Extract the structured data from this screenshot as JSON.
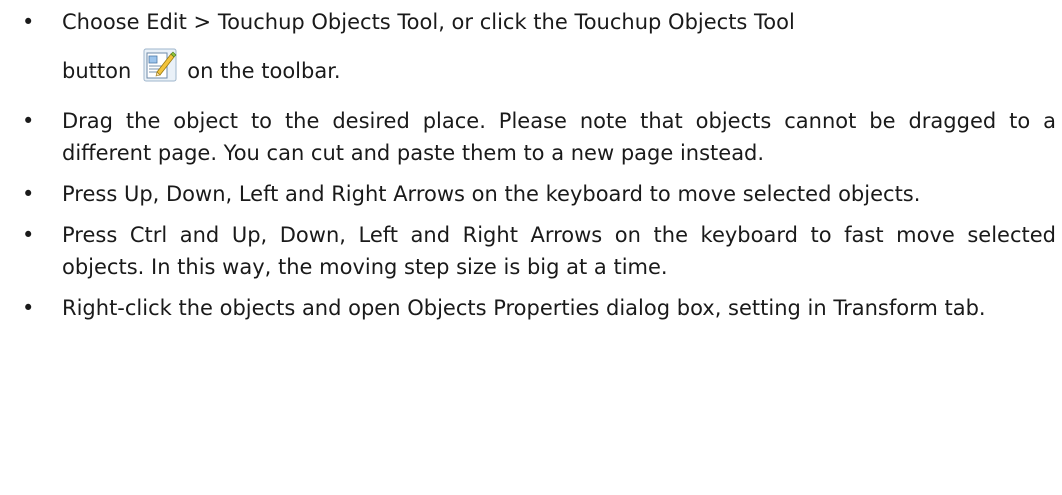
{
  "bullet_glyph": "•",
  "items": [
    {
      "line1": "Choose Edit > Touchup Objects Tool, or click the Touchup Objects Tool",
      "pre_icon": "button",
      "icon": "touchup-objects-tool-icon",
      "post_icon": "on the toolbar."
    },
    {
      "text": "Drag the object to the desired place. Please note that objects cannot be dragged to a different page. You can cut and paste them to a new page instead."
    },
    {
      "text": "Press Up, Down, Left and Right Arrows on the keyboard to move selected objects."
    },
    {
      "text": "Press Ctrl and Up, Down, Left and Right Arrows on the keyboard to fast move selected objects. In this way, the moving step size is big at a time."
    },
    {
      "text": "Right-click the objects and open Objects Properties dialog box, setting in Transform tab."
    }
  ]
}
